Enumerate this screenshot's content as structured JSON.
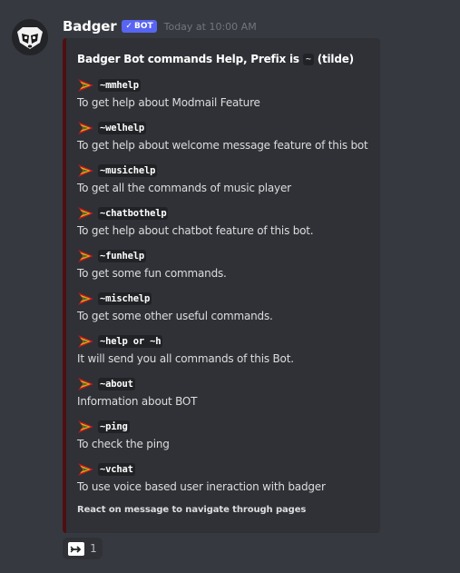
{
  "message": {
    "username": "Badger",
    "bot_tag": "BOT",
    "bot_check": "✓",
    "timestamp": "Today at 10:00 AM",
    "avatar_icon": "badger-avatar-icon"
  },
  "embed": {
    "accent_color": "#4e0f12",
    "title_before": "Badger Bot commands Help, Prefix is",
    "title_prefix": "~",
    "title_after": "(tilde)",
    "fields": [
      {
        "command": "~mmhelp",
        "description": "To get help about Modmail Feature"
      },
      {
        "command": "~welhelp",
        "description": "To get help about welcome message feature of this bot"
      },
      {
        "command": "~musichelp",
        "description": "To get all the commands of music player"
      },
      {
        "command": "~chatbothelp",
        "description": "To get help about chatbot feature of this bot."
      },
      {
        "command": "~funhelp",
        "description": "To get some fun commands."
      },
      {
        "command": "~mischelp",
        "description": "To get some other useful commands."
      },
      {
        "command": "~help or ~h",
        "description": "It will send you all commands of this Bot."
      },
      {
        "command": "~about",
        "description": "Information about BOT"
      },
      {
        "command": "~ping",
        "description": "To check the ping"
      },
      {
        "command": "~vchat",
        "description": "To use voice based user ineraction with badger"
      }
    ],
    "footer": "React on message to navigate through pages"
  },
  "reaction": {
    "emoji": "arrow-right-icon",
    "count": "1"
  }
}
